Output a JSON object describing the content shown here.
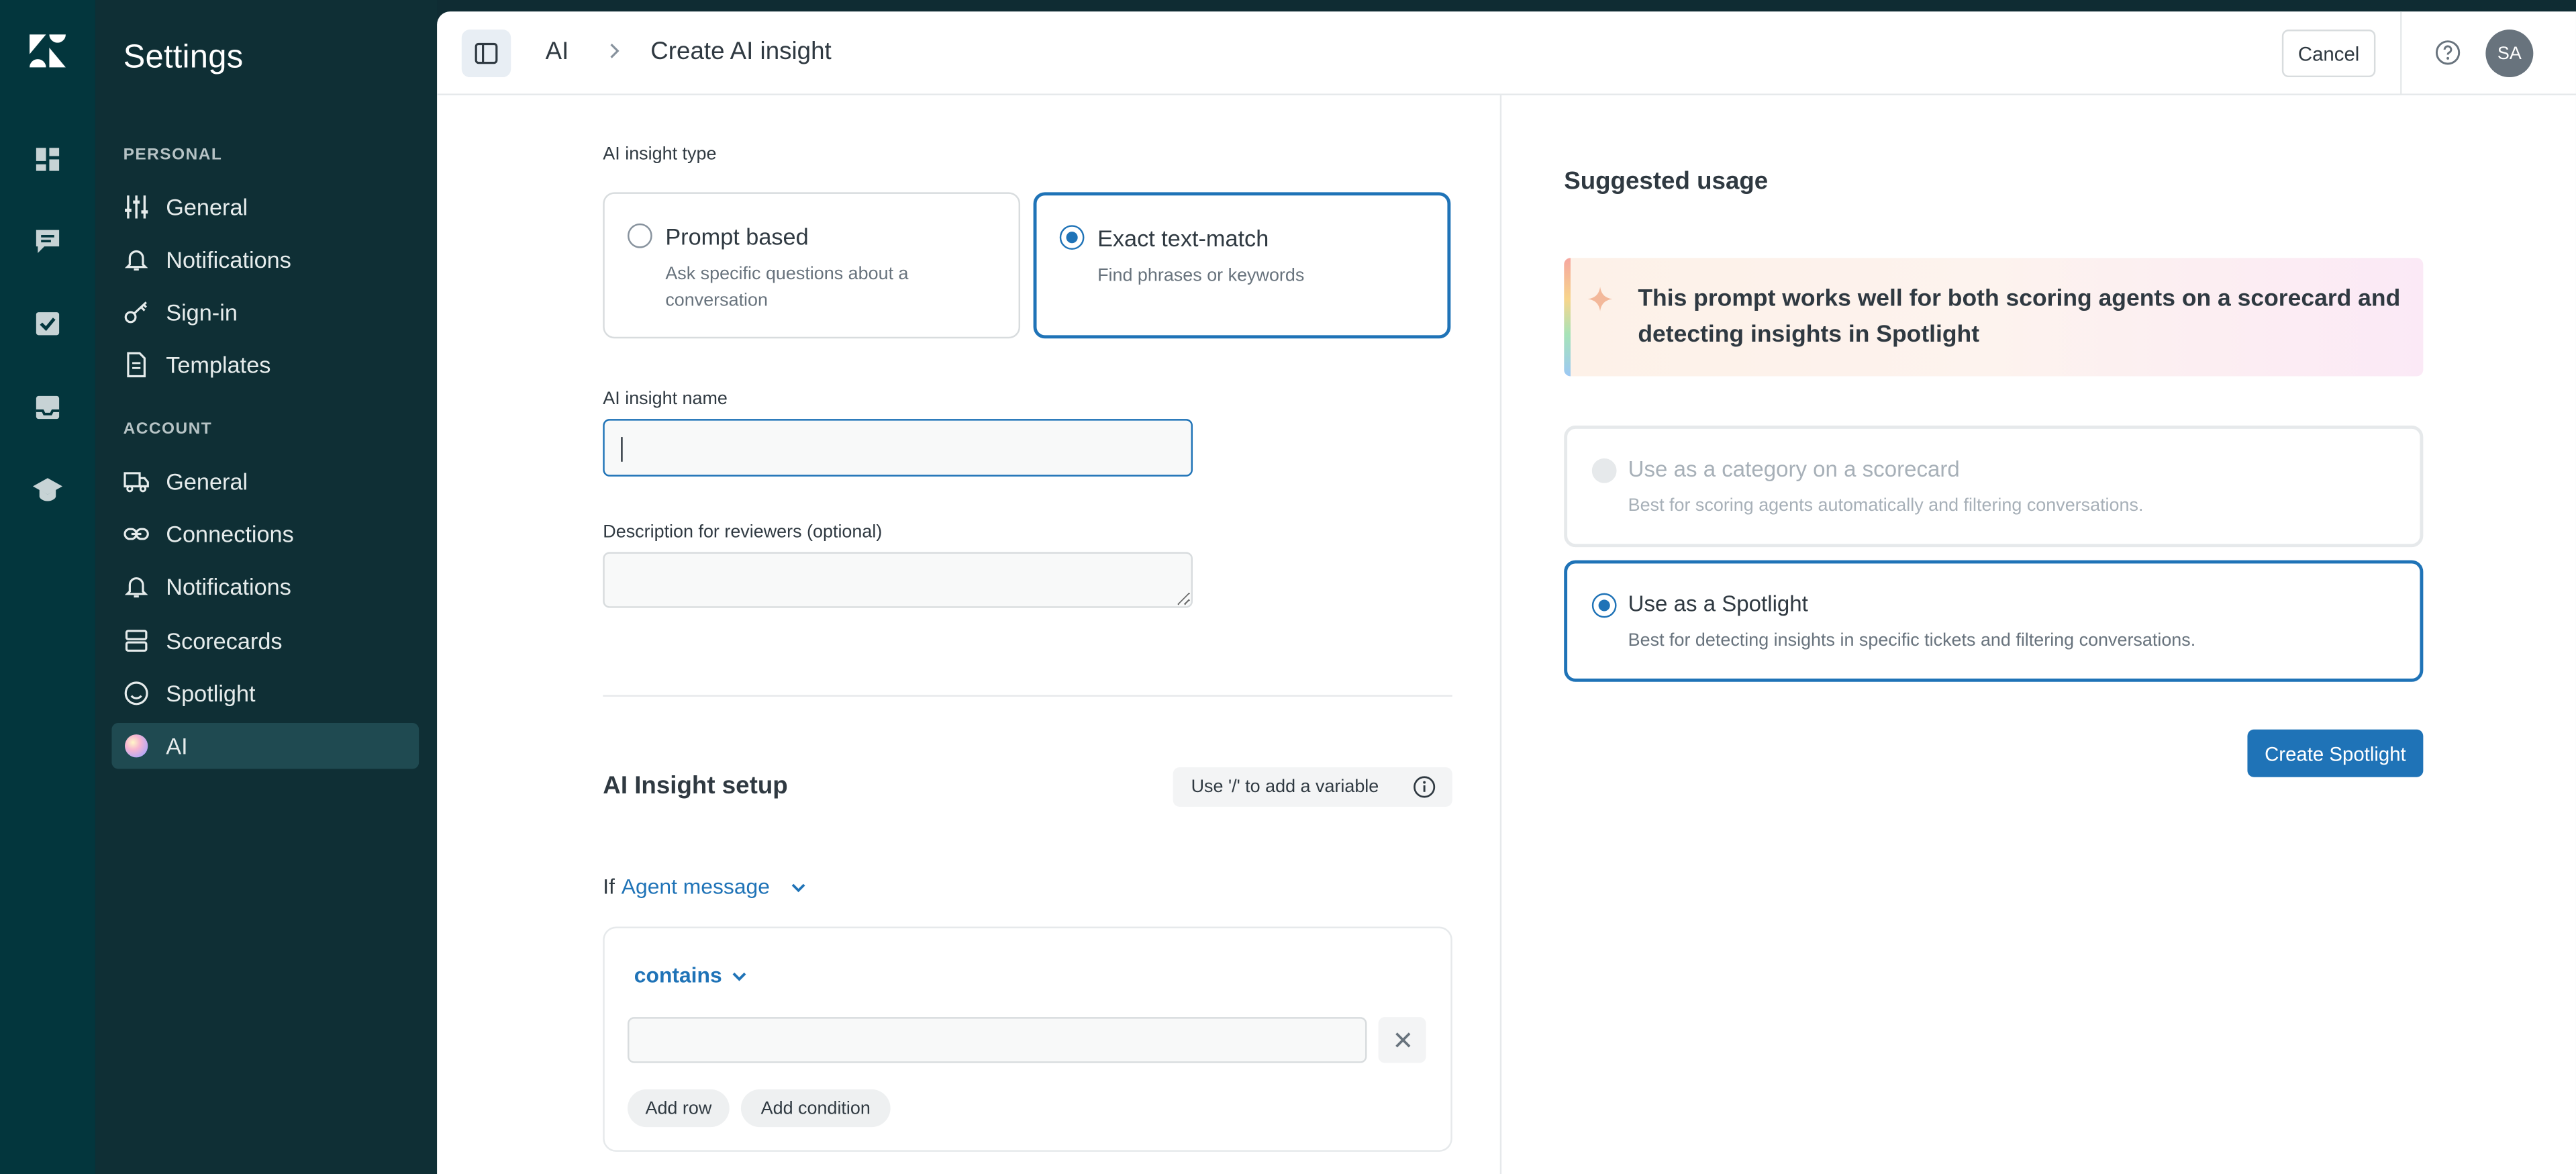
{
  "sidebar": {
    "title": "Settings",
    "personal_heading": "PERSONAL",
    "account_heading": "ACCOUNT",
    "personal_items": [
      {
        "label": "General",
        "icon": "sliders-icon"
      },
      {
        "label": "Notifications",
        "icon": "bell-icon"
      },
      {
        "label": "Sign-in",
        "icon": "key-icon"
      },
      {
        "label": "Templates",
        "icon": "document-icon"
      }
    ],
    "account_items": [
      {
        "label": "General",
        "icon": "truck-icon"
      },
      {
        "label": "Connections",
        "icon": "link-icon"
      },
      {
        "label": "Notifications",
        "icon": "bell-icon"
      },
      {
        "label": "Scorecards",
        "icon": "scorecard-icon"
      },
      {
        "label": "Spotlight",
        "icon": "smiley-icon"
      },
      {
        "label": "AI",
        "icon": "ai-orb-icon",
        "active": true
      }
    ]
  },
  "header": {
    "breadcrumb_root": "AI",
    "breadcrumb_current": "Create AI insight",
    "cancel_label": "Cancel",
    "avatar_initials": "SA"
  },
  "form": {
    "type_label": "AI insight type",
    "types": [
      {
        "title": "Prompt based",
        "description": "Ask specific questions about a conversation",
        "selected": false
      },
      {
        "title": "Exact text-match",
        "description": "Find phrases or keywords",
        "selected": true
      }
    ],
    "name_label": "AI insight name",
    "name_value": "",
    "description_label": "Description for reviewers (optional)",
    "description_value": "",
    "setup_title": "AI Insight setup",
    "variable_hint": "Use '/' to add a variable",
    "if_keyword": "If",
    "if_subject": "Agent message",
    "operator": "contains",
    "condition_value": "",
    "add_row_label": "Add row",
    "add_condition_label": "Add condition"
  },
  "suggested": {
    "title": "Suggested usage",
    "banner_text": "This prompt works well for both scoring agents on a scorecard and detecting insights in Spotlight",
    "options": [
      {
        "title": "Use as a category on a scorecard",
        "description": "Best for scoring agents automatically and filtering conversations.",
        "selected": false,
        "disabled": true
      },
      {
        "title": "Use as a Spotlight",
        "description": "Best for detecting insights in specific tickets and filtering conversations.",
        "selected": true,
        "disabled": false
      }
    ],
    "create_button_label": "Create Spotlight"
  },
  "colors": {
    "rail_bg": "#03363d",
    "sidebar_bg": "#0f2f35",
    "accent": "#1f73b7"
  }
}
